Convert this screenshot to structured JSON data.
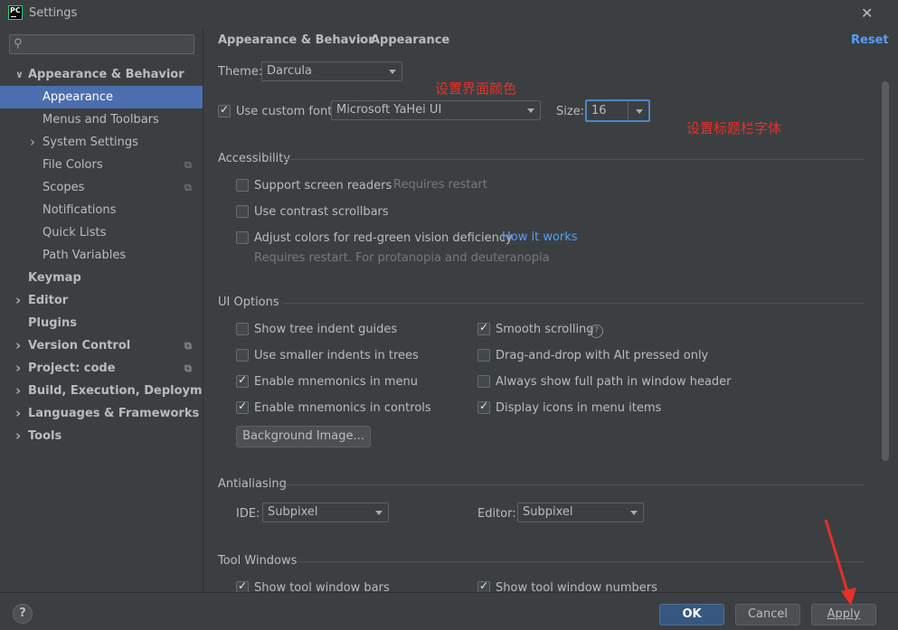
{
  "window": {
    "title": "Settings",
    "app_icon_text": "PC"
  },
  "sidebar": {
    "items": [
      {
        "label": "Appearance & Behavior",
        "bold": true,
        "chevron": "down"
      },
      {
        "label": "Appearance",
        "selected": true
      },
      {
        "label": "Menus and Toolbars"
      },
      {
        "label": "System Settings",
        "chevron": "right"
      },
      {
        "label": "File Colors",
        "project_icon": true
      },
      {
        "label": "Scopes",
        "project_icon": true
      },
      {
        "label": "Notifications"
      },
      {
        "label": "Quick Lists"
      },
      {
        "label": "Path Variables"
      },
      {
        "label": "Keymap",
        "bold": true
      },
      {
        "label": "Editor",
        "bold": true,
        "chevron": "right"
      },
      {
        "label": "Plugins",
        "bold": true
      },
      {
        "label": "Version Control",
        "bold": true,
        "chevron": "right",
        "project_icon": true
      },
      {
        "label": "Project: code",
        "bold": true,
        "chevron": "right",
        "project_icon": true
      },
      {
        "label": "Build, Execution, Deployment",
        "bold": true,
        "chevron": "right"
      },
      {
        "label": "Languages & Frameworks",
        "bold": true,
        "chevron": "right"
      },
      {
        "label": "Tools",
        "bold": true,
        "chevron": "right"
      }
    ]
  },
  "header": {
    "crumb1": "Appearance & Behavior",
    "sep": "›",
    "crumb2": "Appearance",
    "reset": "Reset"
  },
  "theme": {
    "label": "Theme:",
    "value": "Darcula"
  },
  "font": {
    "checkbox": "Use custom font:",
    "value": "Microsoft YaHei UI",
    "size_label": "Size:",
    "size_value": "16"
  },
  "annotations": {
    "note1": "设置界面颜色",
    "note2": "设置标题栏字体"
  },
  "accessibility": {
    "title": "Accessibility",
    "screen_readers": "Support screen readers",
    "requires_restart": "Requires restart",
    "contrast": "Use contrast scrollbars",
    "colors": "Adjust colors for red-green vision deficiency",
    "how_it_works": "How it works",
    "note": "Requires restart. For protanopia and deuteranopia"
  },
  "ui_options": {
    "title": "UI Options",
    "tree_indent": "Show tree indent guides",
    "smaller_indents": "Use smaller indents in trees",
    "mnemonics_menu": "Enable mnemonics in menu",
    "mnemonics_controls": "Enable mnemonics in controls",
    "smooth_scrolling": "Smooth scrolling",
    "drag_drop": "Drag-and-drop with Alt pressed only",
    "full_path": "Always show full path in window header",
    "display_icons": "Display icons in menu items",
    "background_button": "Background Image..."
  },
  "antialiasing": {
    "title": "Antialiasing",
    "ide_label": "IDE:",
    "ide_value": "Subpixel",
    "editor_label": "Editor:",
    "editor_value": "Subpixel"
  },
  "tool_windows": {
    "title": "Tool Windows",
    "bars": "Show tool window bars",
    "numbers": "Show tool window numbers"
  },
  "footer": {
    "help": "?",
    "ok": "OK",
    "cancel": "Cancel",
    "apply": "Apply"
  },
  "colors": {
    "accent": "#4b6eaf",
    "link": "#589df6",
    "annotation": "#e5302a"
  }
}
